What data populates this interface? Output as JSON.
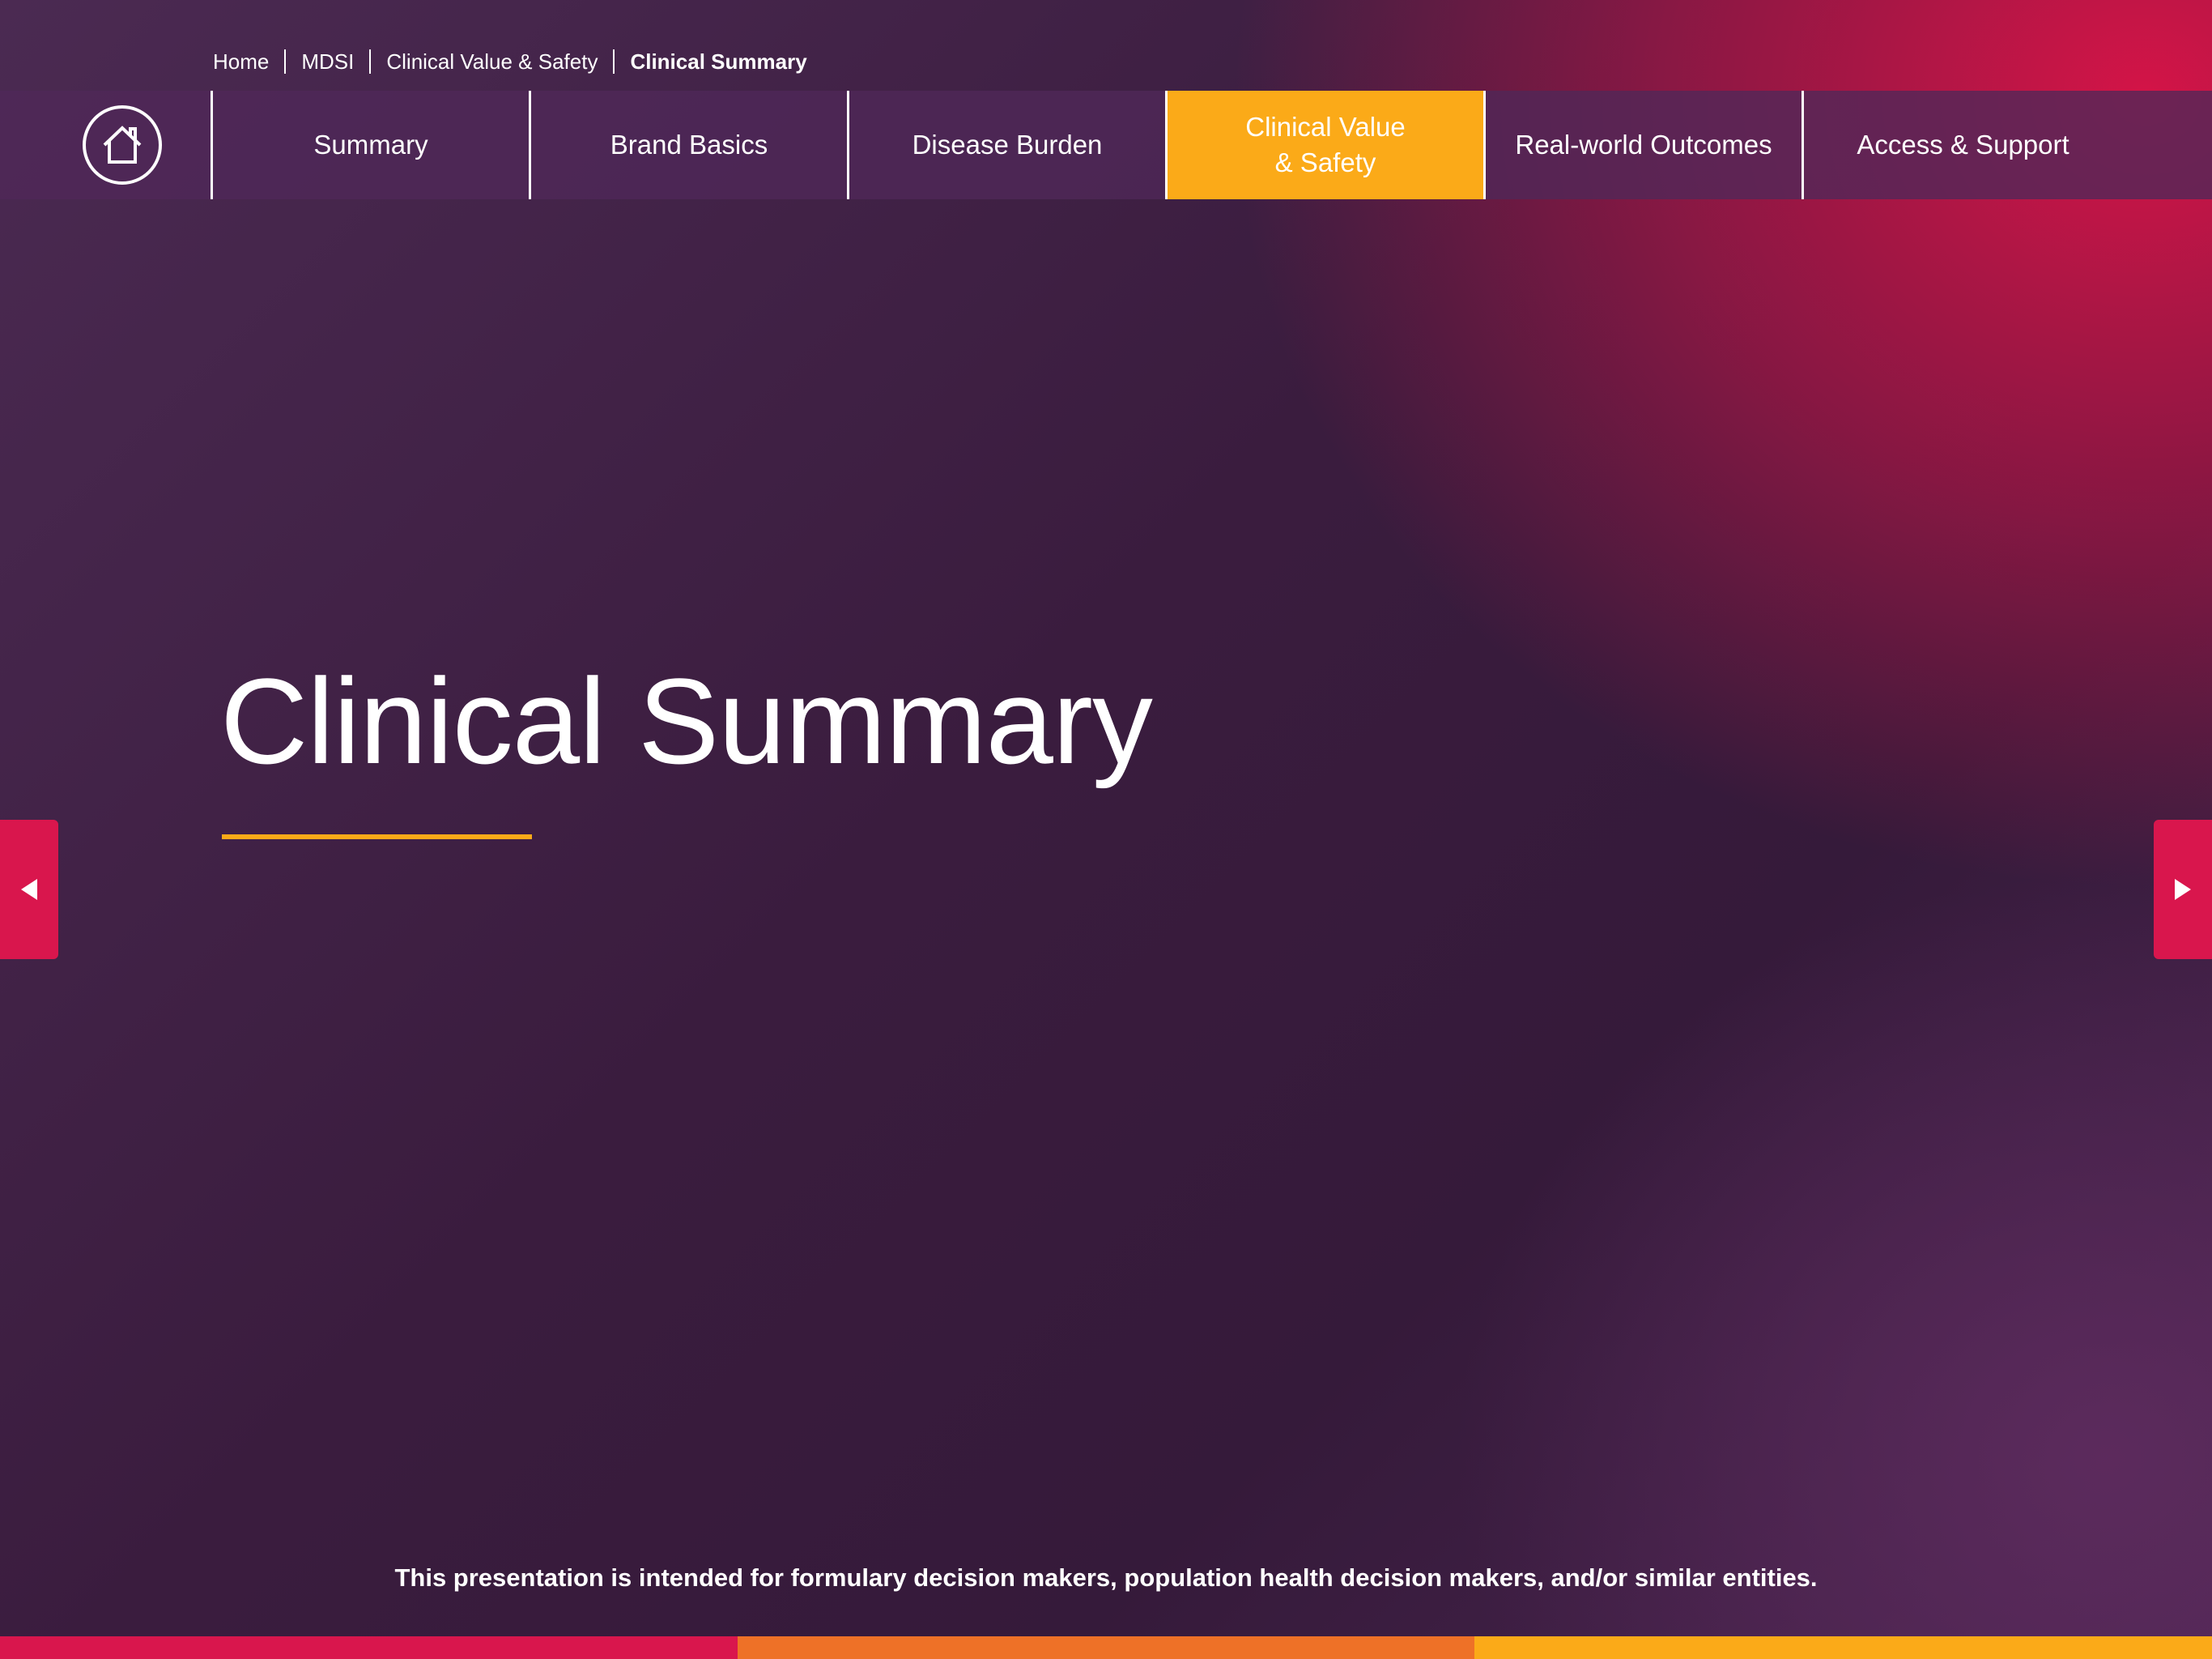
{
  "breadcrumb": {
    "items": [
      "Home",
      "MDSI",
      "Clinical Value & Safety",
      "Clinical Summary"
    ]
  },
  "nav": {
    "home_icon": "home-icon",
    "tabs": [
      {
        "label": "Summary",
        "active": false
      },
      {
        "label": "Brand Basics",
        "active": false
      },
      {
        "label": "Disease Burden",
        "active": false
      },
      {
        "label": "Clinical Value\n& Safety",
        "active": true
      },
      {
        "label": "Real-world Outcomes",
        "active": false
      },
      {
        "label": "Access & Support",
        "active": false
      }
    ]
  },
  "main": {
    "title": "Clinical Summary"
  },
  "controls": {
    "prev_icon": "caret-left-icon",
    "next_icon": "caret-right-icon"
  },
  "footer": {
    "disclaimer": "This presentation is intended for formulary decision makers, population health decision makers, and/or similar entities."
  },
  "colors": {
    "accent": "#fbaa18",
    "brand_red": "#d9164d",
    "nav_bg": "#502858",
    "stripe": [
      "#d9164d",
      "#ee7127",
      "#fbaa18"
    ]
  }
}
